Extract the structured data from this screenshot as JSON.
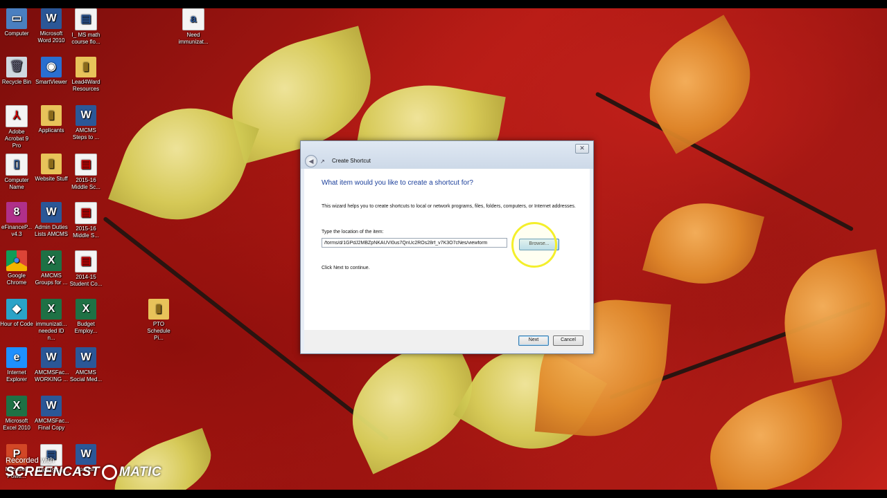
{
  "desktop": {
    "icons": [
      {
        "label": "Computer",
        "glyph": "▭",
        "kind": "comp",
        "icon": "computer-icon"
      },
      {
        "label": "Microsoft Word 2010",
        "glyph": "W",
        "kind": "word",
        "icon": "word-icon"
      },
      {
        "label": "I_ MS math course flo...",
        "glyph": "▤",
        "kind": "doc",
        "icon": "document-icon"
      },
      {
        "label": "Need immunizat...",
        "glyph": "a",
        "kind": "doc",
        "icon": "document-icon"
      },
      {
        "label": "Recycle Bin",
        "glyph": "🗑",
        "kind": "bin",
        "icon": "recycle-bin-icon"
      },
      {
        "label": "SmartViewer",
        "glyph": "◉",
        "kind": "sv",
        "icon": "smartviewer-icon"
      },
      {
        "label": "Lead4Ward Resources",
        "glyph": "▮",
        "kind": "folder",
        "icon": "folder-icon"
      },
      {
        "label": "Adobe Acrobat 9 Pro",
        "glyph": "⅄",
        "kind": "pdf",
        "icon": "acrobat-icon"
      },
      {
        "label": "Applicants",
        "glyph": "▮",
        "kind": "folder",
        "icon": "folder-icon"
      },
      {
        "label": "AMCMS Steps to ...",
        "glyph": "W",
        "kind": "word",
        "icon": "word-doc-icon"
      },
      {
        "label": "Computer Name",
        "glyph": "▯",
        "kind": "doc",
        "icon": "document-icon"
      },
      {
        "label": "Website Stuff",
        "glyph": "▮",
        "kind": "folder",
        "icon": "folder-icon"
      },
      {
        "label": "2015-16 Middle Sc...",
        "glyph": "▤",
        "kind": "pdf",
        "icon": "pdf-icon"
      },
      {
        "label": "eFinanceP... v4.3",
        "glyph": "8",
        "kind": "ef",
        "icon": "efinance-icon"
      },
      {
        "label": "Admin Duties Lists AMCMS",
        "glyph": "W",
        "kind": "word",
        "icon": "word-doc-icon"
      },
      {
        "label": "2015-16 Middle S...",
        "glyph": "▤",
        "kind": "pdf",
        "icon": "pdf-icon"
      },
      {
        "label": "Google Chrome",
        "glyph": "●",
        "kind": "chrome",
        "icon": "chrome-icon"
      },
      {
        "label": "AMCMS Groups for ...",
        "glyph": "X",
        "kind": "xl",
        "icon": "excel-doc-icon"
      },
      {
        "label": "2014-15 Student Co...",
        "glyph": "▤",
        "kind": "pdf",
        "icon": "pdf-icon"
      },
      {
        "label": "Hour of Code",
        "glyph": "◆",
        "kind": "hoc",
        "icon": "hour-of-code-icon"
      },
      {
        "label": "immunizati... needed ID n...",
        "glyph": "X",
        "kind": "xl",
        "icon": "excel-doc-icon"
      },
      {
        "label": "Budget Employ...",
        "glyph": "X",
        "kind": "xl",
        "icon": "excel-doc-icon"
      },
      {
        "label": "PTO Schedule Pi...",
        "glyph": "▮",
        "kind": "folder",
        "icon": "archive-icon"
      },
      {
        "label": "Internet Explorer",
        "glyph": "e",
        "kind": "ie",
        "icon": "internet-explorer-icon"
      },
      {
        "label": "AMCMSFac... WORKING ...",
        "glyph": "W",
        "kind": "word",
        "icon": "word-doc-icon"
      },
      {
        "label": "AMCMS Social Med...",
        "glyph": "W",
        "kind": "word",
        "icon": "word-doc-icon"
      },
      {
        "label": "Microsoft Excel 2010",
        "glyph": "X",
        "kind": "xl",
        "icon": "excel-icon"
      },
      {
        "label": "AMCMSFac... Final Copy",
        "glyph": "W",
        "kind": "word",
        "icon": "word-doc-icon"
      },
      {
        "label": "Microsoft Powe...",
        "glyph": "P",
        "kind": "ppt",
        "icon": "powerpoint-icon"
      },
      {
        "label": "AMCMSFac...",
        "glyph": "▤",
        "kind": "doc",
        "icon": "document-icon"
      },
      {
        "label": "Spanish",
        "glyph": "W",
        "kind": "word",
        "icon": "word-doc-icon"
      }
    ]
  },
  "dialog": {
    "title": "Create Shortcut",
    "close_glyph": "✕",
    "back_glyph": "◀",
    "heading": "What item would you like to create a shortcut for?",
    "description": "This wizard helps you to create shortcuts to local or network programs, files, folders, computers, or Internet addresses.",
    "location_label": "Type the location of the item:",
    "location_value": "/forms/d/1GPdJ2MBZpNKAUVI0us7QnUc2ROs28rf_v7K3O7cNes/viewform",
    "browse_label": "Browse...",
    "next_message": "Click Next to continue.",
    "next_label": "Next",
    "cancel_label": "Cancel"
  },
  "watermark": {
    "line1": "Recorded with",
    "line2a": "SCREENCAST",
    "line2b": "MATIC"
  }
}
